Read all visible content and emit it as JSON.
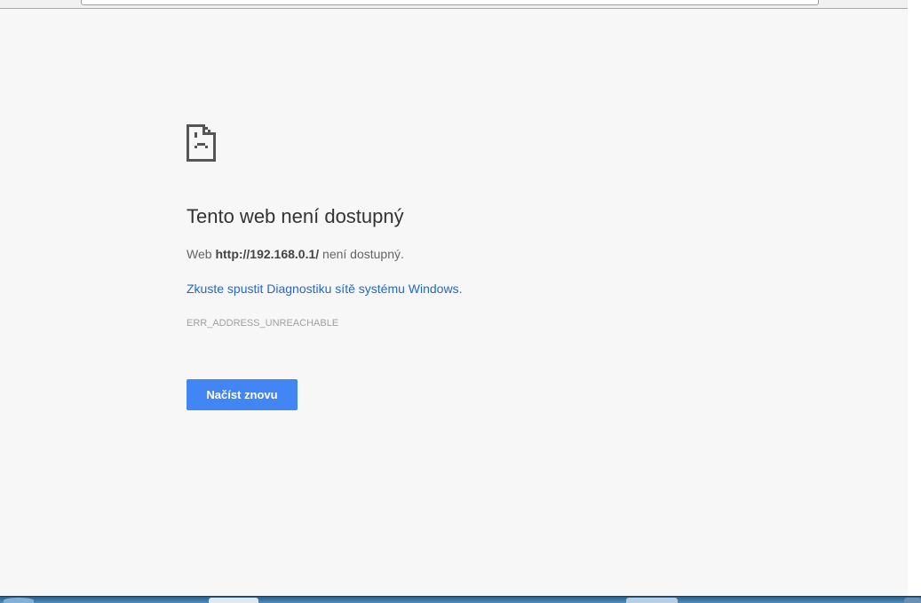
{
  "page": {
    "title": "Tento web není dostupný",
    "message_prefix": "Web ",
    "url": "http://192.168.0.1/",
    "message_suffix": " není dostupný.",
    "suggestion_prefix": "Zkuste spustit ",
    "suggestion_link": "Diagnostiku sítě systému Windows",
    "suggestion_suffix": ".",
    "error_code": "ERR_ADDRESS_UNREACHABLE",
    "reload_label": "Načíst znovu",
    "icon": "sad-page-icon"
  },
  "colors": {
    "accent": "#4285f4",
    "link": "#2168d0",
    "background": "#f7f7f7"
  }
}
